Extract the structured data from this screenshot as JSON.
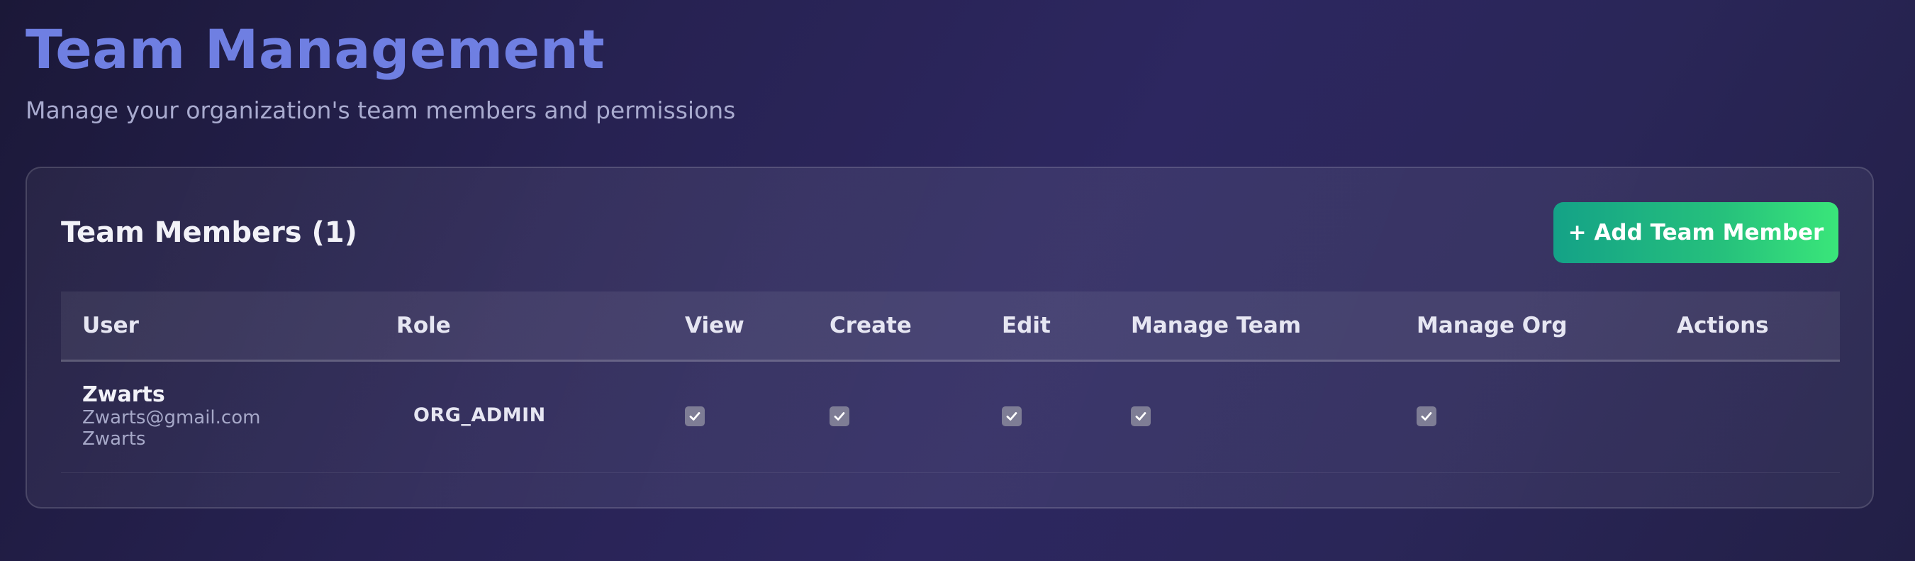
{
  "page": {
    "title": "Team Management",
    "subtitle": "Manage your organization's team members and permissions"
  },
  "card": {
    "title": "Team Members (1)",
    "add_button_label": "+ Add Team Member"
  },
  "table": {
    "headers": {
      "user": "User",
      "role": "Role",
      "view": "View",
      "create": "Create",
      "edit": "Edit",
      "manage_team": "Manage Team",
      "manage_org": "Manage Org",
      "actions": "Actions"
    },
    "rows": [
      {
        "name": "Zwarts",
        "email": "Zwarts@gmail.com",
        "sub": "Zwarts",
        "role": "ORG_ADMIN",
        "view": true,
        "create": true,
        "edit": true,
        "manage_team": true,
        "manage_org": true
      }
    ]
  },
  "colors": {
    "title": "#6f7fe2",
    "button_start": "#14a287",
    "button_end": "#3ae67a",
    "checkbox": "#7e7d95"
  },
  "icons": {
    "checkbox_checked": "check-icon"
  }
}
